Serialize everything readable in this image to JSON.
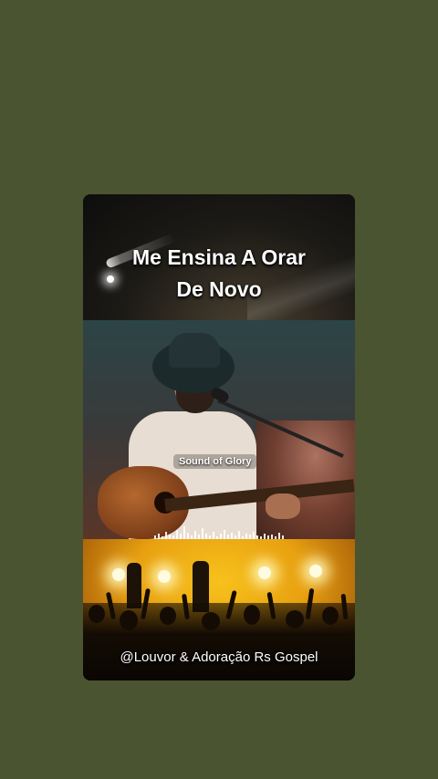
{
  "video": {
    "title_line1": "Me Ensina A Orar",
    "title_line2": "De Novo",
    "watermark": "Sound of Glory",
    "channel_handle": "@Louvor & Adoração Rs Gospel"
  },
  "colors": {
    "background": "#4b5431",
    "stage_light": "#f7c21c"
  }
}
